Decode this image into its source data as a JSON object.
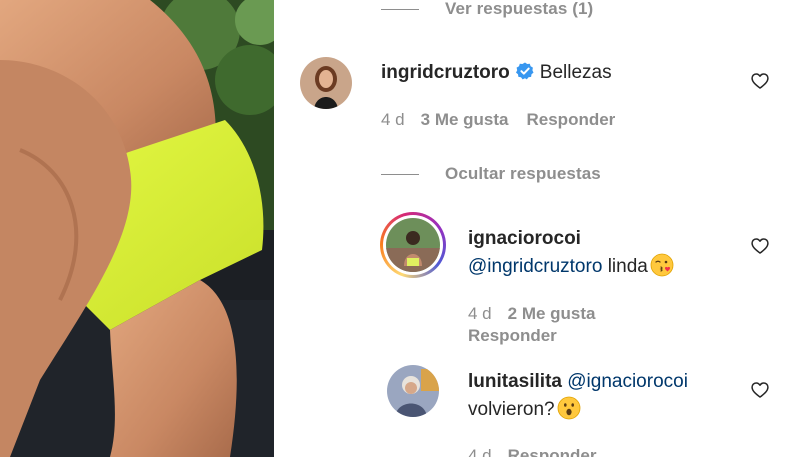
{
  "thread": {
    "view_replies_label": "Ver respuestas (1)",
    "hide_replies_label": "Ocultar respuestas"
  },
  "comments": [
    {
      "username": "ingridcruztoro",
      "verified": true,
      "text": "Bellezas",
      "time": "4 d",
      "likes": "3 Me gusta",
      "reply_label": "Responder"
    }
  ],
  "replies": [
    {
      "username": "ignaciorocoi",
      "mention": "@ingridcruztoro",
      "text": "linda",
      "emoji": "kissing-face-wink-emoji",
      "time": "4 d",
      "likes": "2 Me gusta",
      "reply_label": "Responder"
    },
    {
      "username": "lunitasilita",
      "mention": "@ignaciorocoi",
      "text": "volvieron?",
      "emoji": "surprised-face-emoji",
      "time": "4 d",
      "reply_label": "Responder"
    }
  ],
  "colors": {
    "text": "#262626",
    "secondary": "#8e8e8e",
    "mention": "#00376b",
    "verified": "#3897f0",
    "shorts": "#dff53a"
  }
}
